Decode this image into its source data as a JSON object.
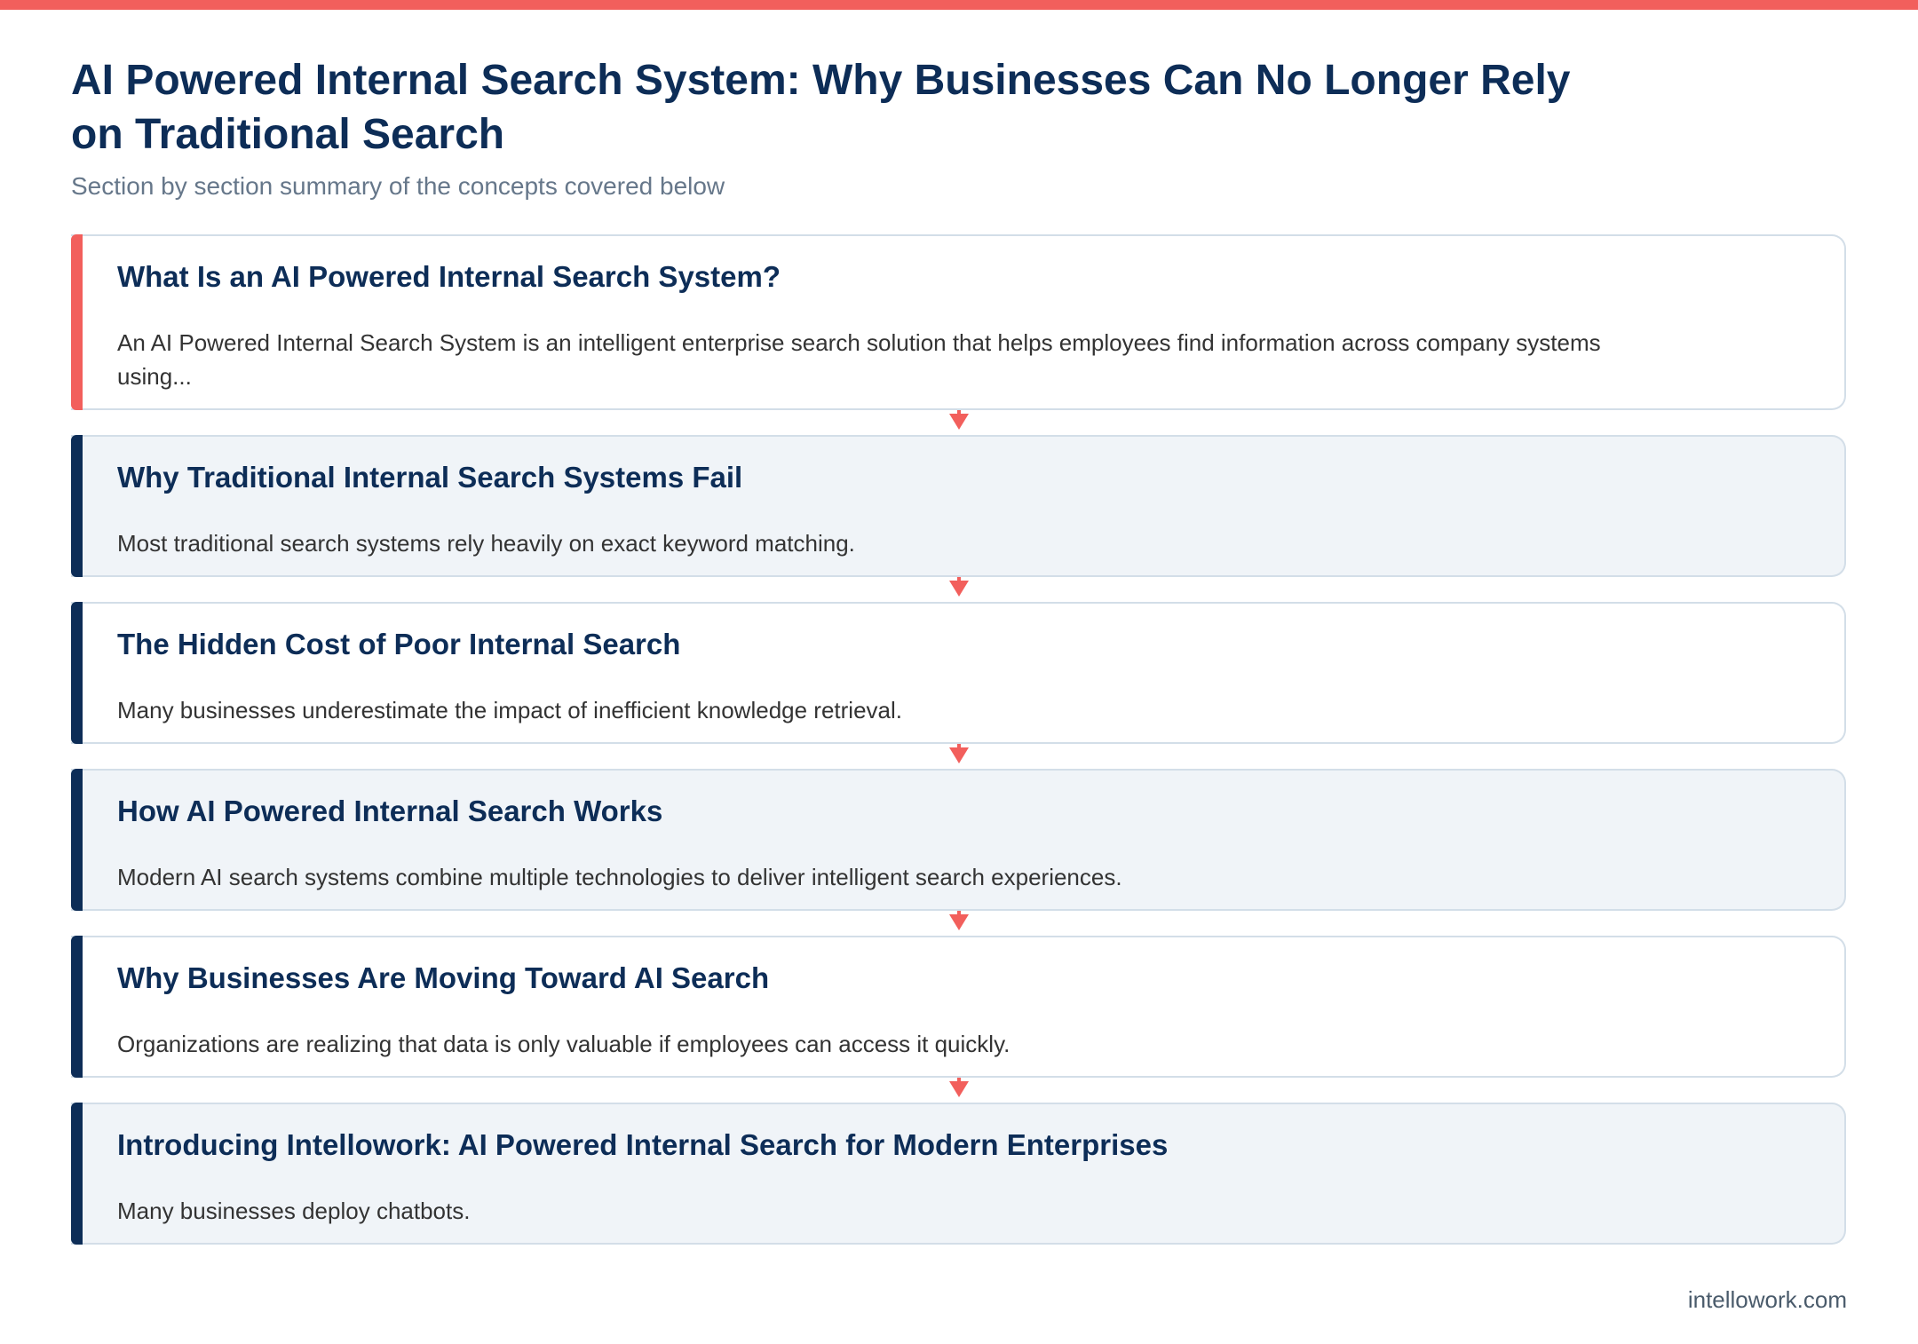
{
  "colors": {
    "accent": "#f25f5c",
    "navy": "#0d2d57",
    "card_alt_bg": "#f0f4f8",
    "border": "#d3dee8",
    "subtitle": "#66778a"
  },
  "header": {
    "title": "AI Powered Internal Search System: Why Businesses Can No Longer Rely on Traditional Search",
    "subtitle": "Section by section summary of the concepts covered below"
  },
  "sections": [
    {
      "title": "What Is an AI Powered Internal Search System?",
      "text": "An AI Powered Internal Search System is an intelligent enterprise search solution that helps employees find information across company systems using..."
    },
    {
      "title": "Why Traditional Internal Search Systems Fail",
      "text": "Most traditional search systems rely heavily on exact keyword matching."
    },
    {
      "title": "The Hidden Cost of Poor Internal Search",
      "text": "Many businesses underestimate the impact of inefficient knowledge retrieval."
    },
    {
      "title": "How AI Powered Internal Search Works",
      "text": "Modern AI search systems combine multiple technologies to deliver intelligent search experiences."
    },
    {
      "title": "Why Businesses Are Moving Toward AI Search",
      "text": "Organizations are realizing that data is only valuable if employees can access it quickly."
    },
    {
      "title": "Introducing Intellowork: AI Powered Internal Search for Modern Enterprises",
      "text": "Many businesses deploy chatbots."
    }
  ],
  "footer": {
    "site": "intellowork.com"
  }
}
